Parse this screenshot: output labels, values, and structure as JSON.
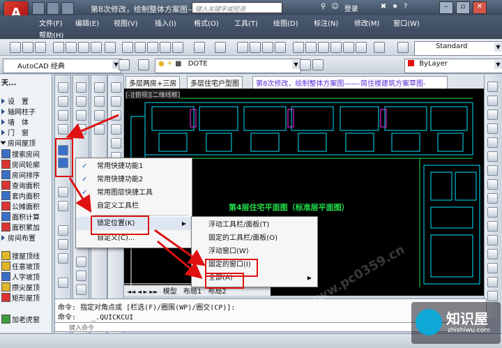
{
  "titlebar": {
    "logo": "A",
    "title": "第8次修改，绘制整体方案图——-简...",
    "search_placeholder": "键入关键字或短语",
    "login": "登录",
    "help": "?",
    "min": "–",
    "restore": "▫",
    "close": "✕"
  },
  "menubar": {
    "items": [
      "文件(F)",
      "编辑(E)",
      "视图(V)",
      "插入(I)",
      "格式(O)",
      "工具(T)",
      "绘图(D)",
      "标注(N)",
      "修改(M)",
      "窗口(W)",
      "帮助(H)"
    ]
  },
  "toolbar": {
    "workspace": "AutoCAD 经典",
    "layer": "DOTE",
    "style": "Standard",
    "linetype": "ByLayer"
  },
  "leftpanel": {
    "header": "天...",
    "items": [
      "设　置",
      "轴网柱子",
      "墙　体",
      "门　窗",
      "房间屋顶",
      "搜索房间",
      "房间轮廓",
      "房间排序",
      "查询面积",
      "套内面积",
      "公摊面积",
      "面积计算",
      "面积累加",
      "房间布置",
      "搜屋顶线",
      "任意坡顶",
      "人字坡顶",
      "攒尖屋顶",
      "矩形屋顶",
      "加老虎窗"
    ]
  },
  "doc_tabs": [
    "多层两房+三房",
    "多层住宅户型图",
    "第8次修改，绘制整体方案图——-简住楼建筑方案草图-"
  ],
  "canvas": {
    "header_label": "[-][俯视][二维线框]",
    "floor_plan_label": "第4层住宅平面图（标准层平面图）",
    "layout_tabs": [
      "模型",
      "布局1",
      "布局2"
    ]
  },
  "context_menu": {
    "items": [
      {
        "label": "常用快捷功能1",
        "checked": true
      },
      {
        "label": "常用快捷功能2",
        "checked": true
      },
      {
        "label": "常用图层快捷工具",
        "checked": true
      },
      {
        "label": "自定义工具栏",
        "checked": true
      },
      {
        "label": "锁定位置(K)",
        "submenu": true
      },
      {
        "label": "自定义(C)..."
      }
    ]
  },
  "submenu": {
    "items": [
      "浮动工具栏/面板(T)",
      "固定的工具栏/面板(O)",
      "浮动窗口(W)",
      "固定的窗口(I)",
      "全部(A)"
    ]
  },
  "command": {
    "line1_prefix": "命令:",
    "line1": "指定对角点或 [栏选(F)/圈围(WP)/圈交(CP)]:",
    "line2_prefix": "命令:",
    "line2": "_.QUICKCUI",
    "input_placeholder": "键入命令"
  },
  "watermark": {
    "brand": "知识屋",
    "domain": "zhishiwu.com",
    "bg_text": "www.pc0359.cn"
  },
  "colors": {
    "highlight_red": "#e01010",
    "cad_cyan": "#00ffff",
    "cad_green": "#22e04a",
    "cad_magenta": "#ff2bff"
  }
}
